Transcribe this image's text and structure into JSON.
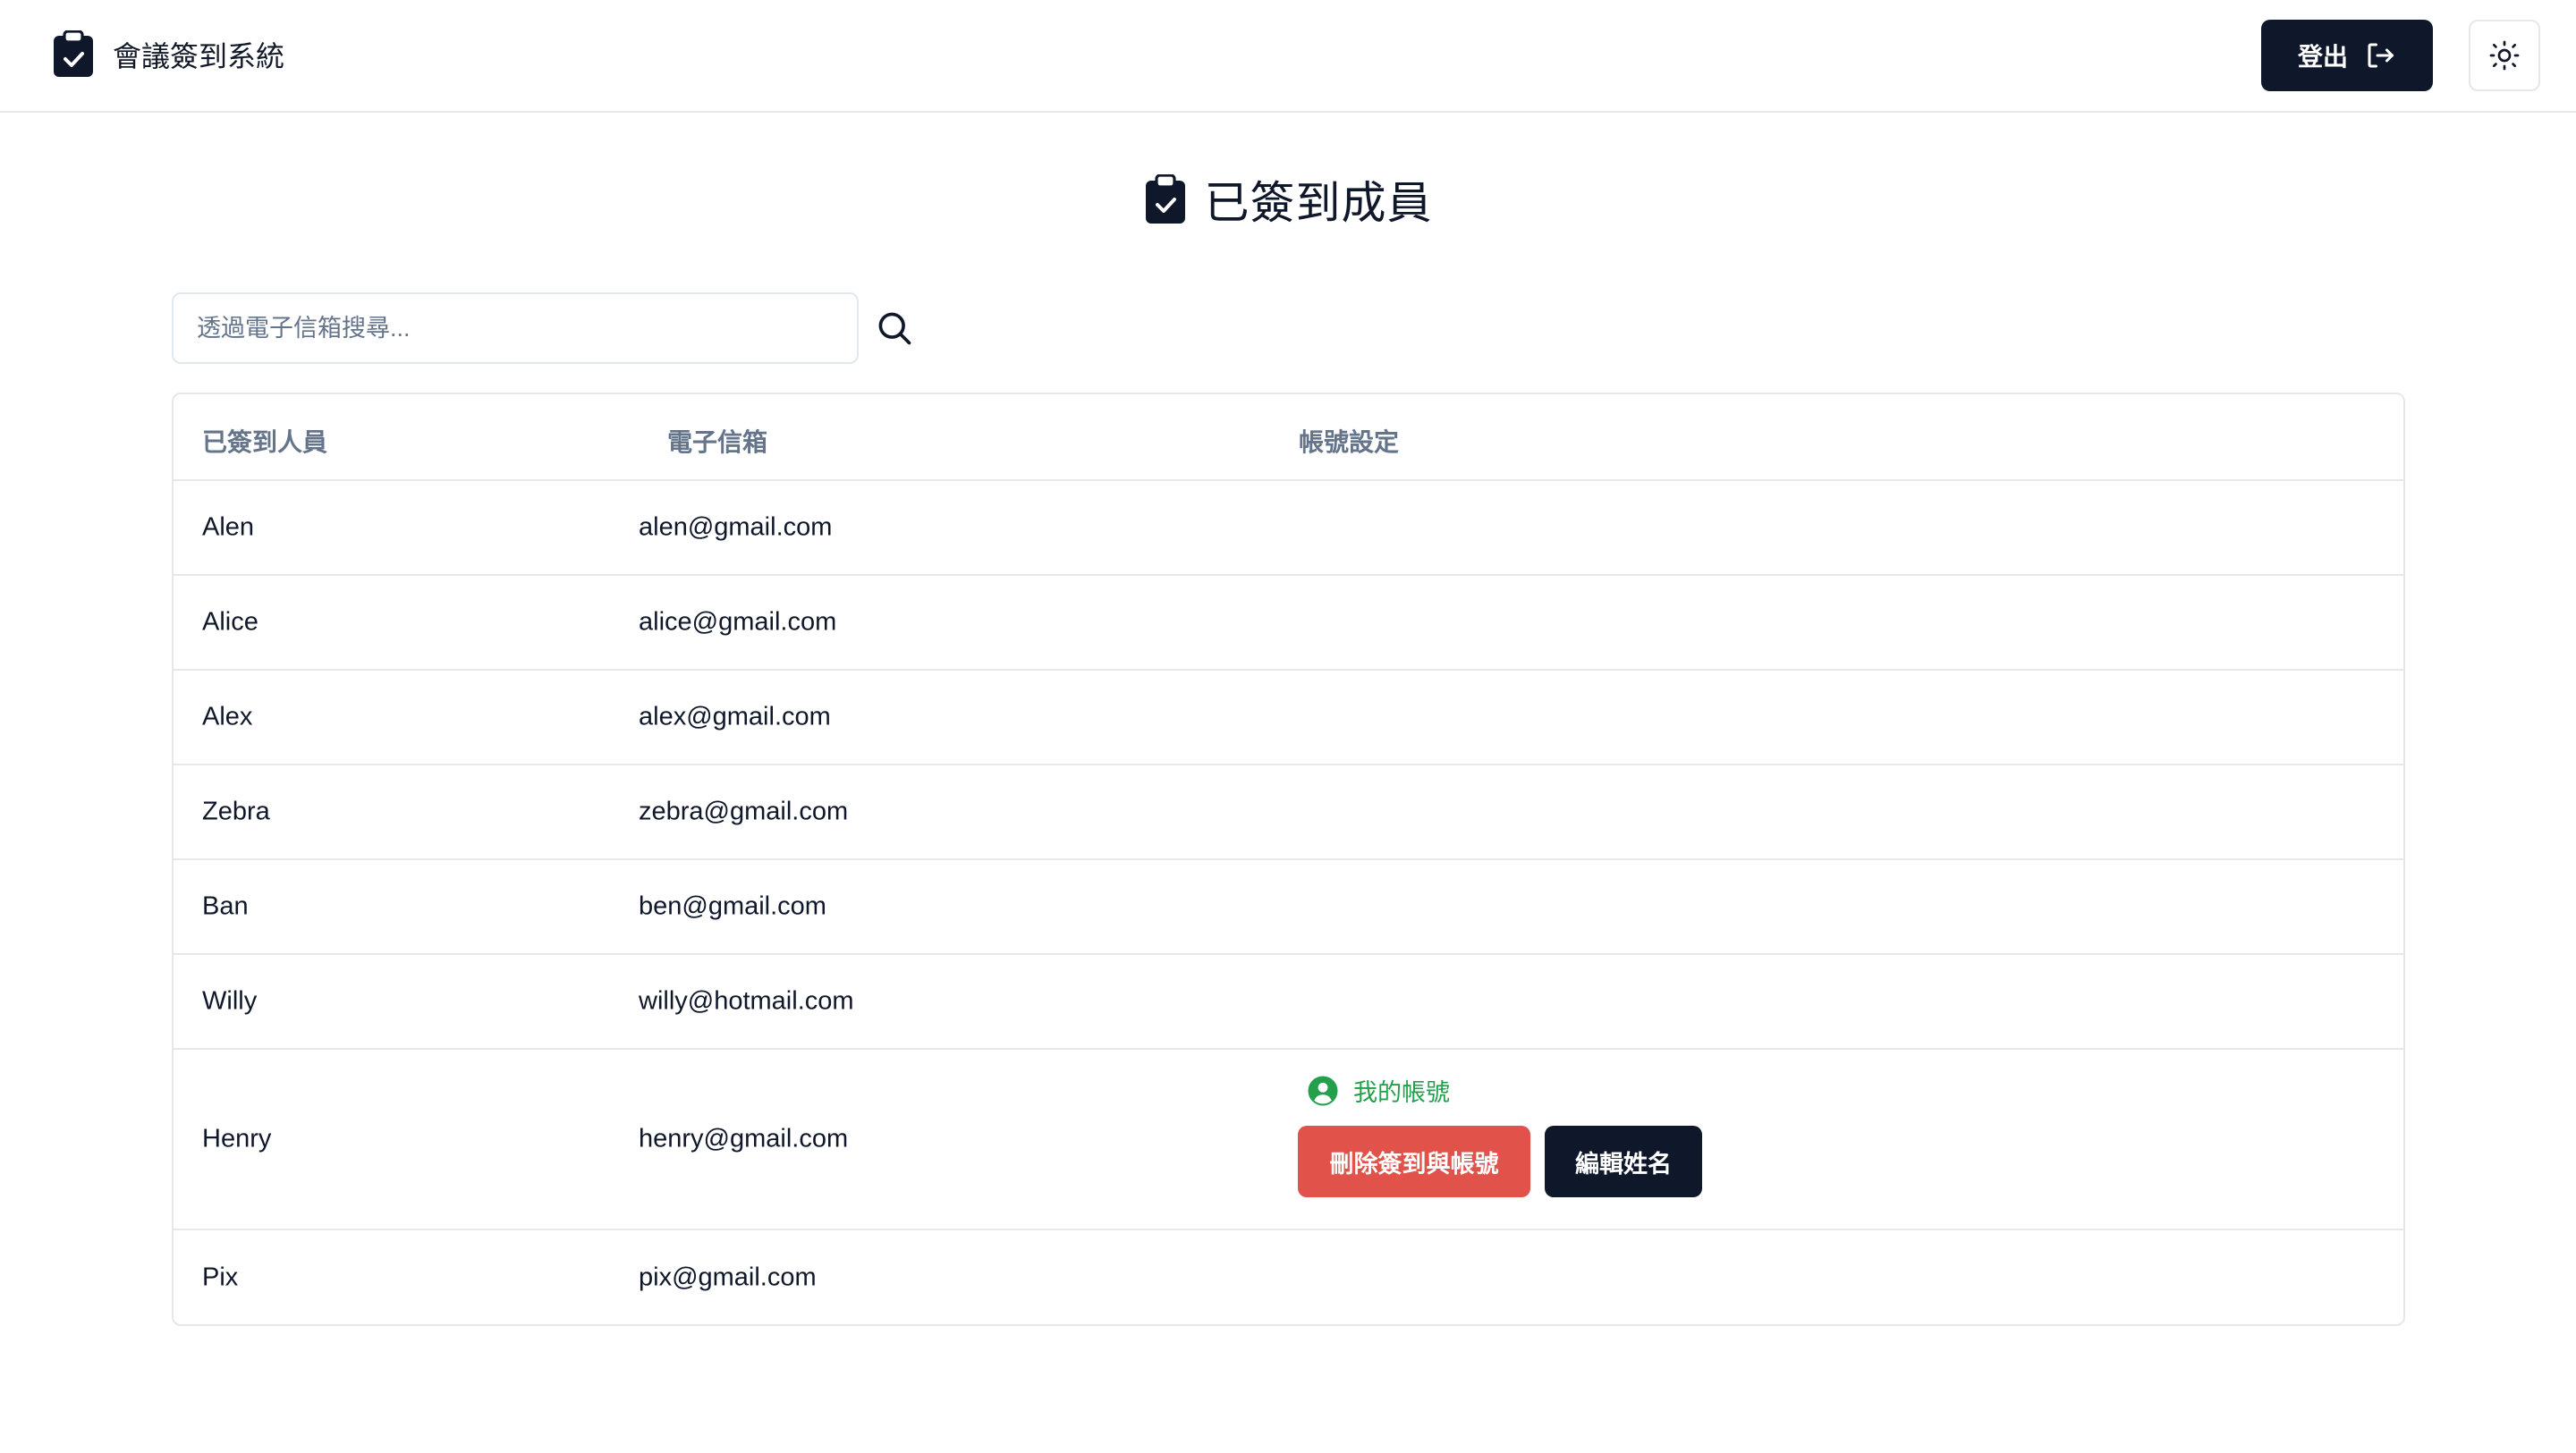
{
  "app": {
    "title": "會議簽到系統"
  },
  "header": {
    "logout_label": "登出"
  },
  "page": {
    "title": "已簽到成員"
  },
  "search": {
    "placeholder": "透過電子信箱搜尋..."
  },
  "table": {
    "columns": [
      "已簽到人員",
      "電子信箱",
      "帳號設定"
    ],
    "rows": [
      {
        "name": "Alen",
        "email": "alen@gmail.com"
      },
      {
        "name": "Alice",
        "email": "alice@gmail.com"
      },
      {
        "name": "Alex",
        "email": "alex@gmail.com"
      },
      {
        "name": "Zebra",
        "email": "zebra@gmail.com"
      },
      {
        "name": "Ban",
        "email": "ben@gmail.com"
      },
      {
        "name": "Willy",
        "email": "willy@hotmail.com"
      },
      {
        "name": "Henry",
        "email": "henry@gmail.com",
        "badge": "我的帳號",
        "delete_label": "刪除簽到與帳號",
        "edit_label": "編輯姓名"
      },
      {
        "name": "Pix",
        "email": "pix@gmail.com"
      }
    ]
  },
  "colors": {
    "primary": "#0f172a",
    "danger": "#e0524a",
    "success": "#22a04b",
    "muted": "#64748b",
    "border": "#e5e7eb"
  },
  "icons": [
    "clipboard-check-icon",
    "logout-icon",
    "sun-icon",
    "search-icon",
    "user-circle-icon"
  ]
}
